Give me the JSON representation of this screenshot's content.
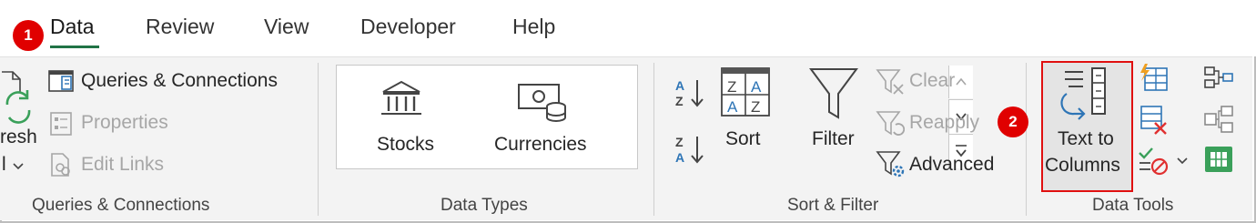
{
  "tabs": [
    {
      "label": "Data"
    },
    {
      "label": "Review"
    },
    {
      "label": "View"
    },
    {
      "label": "Developer"
    },
    {
      "label": "Help"
    }
  ],
  "badges": {
    "one": "1",
    "two": "2"
  },
  "queries_group": {
    "refresh_label_line1": "resh",
    "refresh_label_line2": "l",
    "queries_connections": "Queries & Connections",
    "properties": "Properties",
    "edit_links": "Edit Links",
    "group_label": "Queries & Connections"
  },
  "data_types_group": {
    "stocks": "Stocks",
    "currencies": "Currencies",
    "group_label": "Data Types"
  },
  "sort_filter_group": {
    "sort": "Sort",
    "filter": "Filter",
    "clear": "Clear",
    "reapply": "Reapply",
    "advanced": "Advanced",
    "group_label": "Sort & Filter"
  },
  "data_tools_group": {
    "text_to_line1": "Text to",
    "text_to_line2": "Columns",
    "group_label": "Data Tools"
  },
  "colors": {
    "accent_green": "#217346",
    "highlight_red": "#e01010",
    "badge_red": "#e00000",
    "icon_blue": "#2e75b6"
  }
}
